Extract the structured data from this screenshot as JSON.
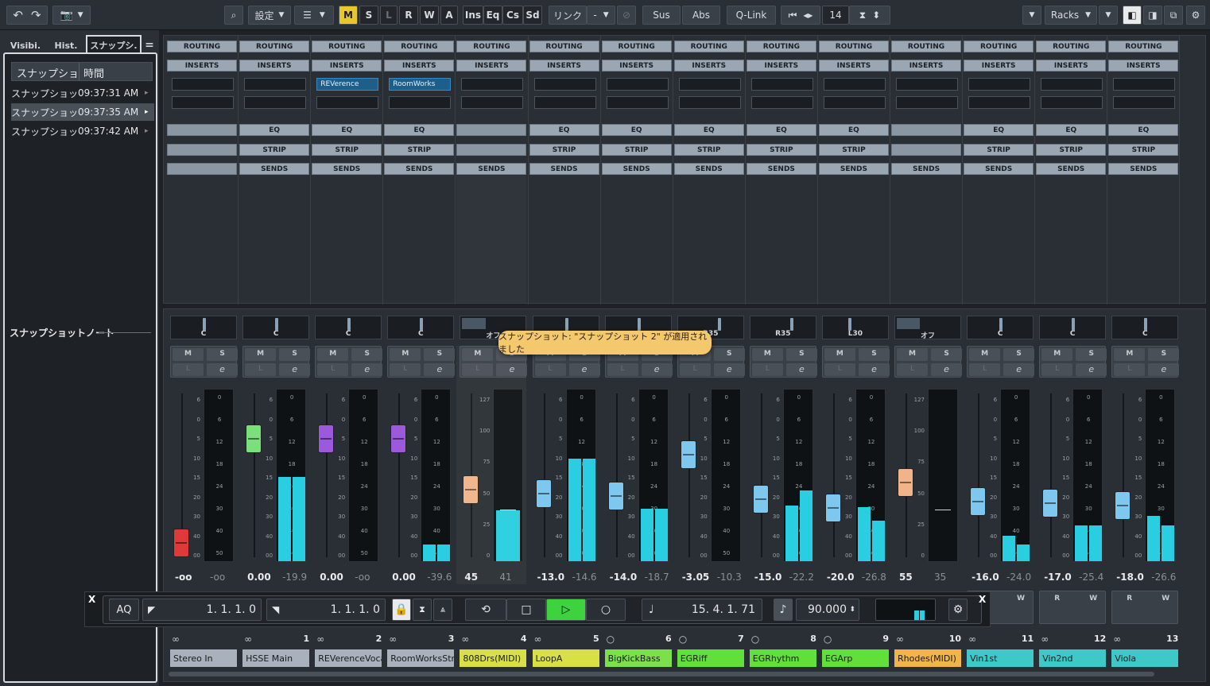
{
  "toolbar": {
    "undo_icon": "undo-icon",
    "redo_icon": "redo-icon",
    "settings_label": "設定",
    "m_label": "M",
    "s_label": "S",
    "l_label": "L",
    "r_label": "R",
    "w_label": "W",
    "a_label": "A",
    "ins_label": "Ins",
    "eq_label": "Eq",
    "cs_label": "Cs",
    "sd_label": "Sd",
    "link_label": "リンク",
    "link_value": "-",
    "sus_label": "Sus",
    "abs_label": "Abs",
    "qlink_label": "Q-Link",
    "channel_count": "14",
    "racks_label": "Racks"
  },
  "left_panel": {
    "tabs": [
      "Visibi.",
      "Hist.",
      "スナップシ."
    ],
    "menu_icon": "=",
    "columns": [
      "スナップショット",
      "時間"
    ],
    "snapshots": [
      {
        "name": "スナップショット",
        "time": "09:37:31 AM"
      },
      {
        "name": "スナップショット",
        "time": "09:37:35 AM"
      },
      {
        "name": "スナップショット",
        "time": "09:37:42 AM"
      }
    ],
    "notes_label": "スナップショットノート"
  },
  "rack": {
    "routing": "ROUTING",
    "inserts": "INSERTS",
    "eq": "EQ",
    "strip": "STRIP",
    "sends": "SENDS",
    "insert_slots": {
      "2": "REVerence",
      "3": "RoomWorks"
    }
  },
  "channels": [
    {
      "num": "",
      "pan": "C",
      "level": "-oo",
      "peak": "-oo",
      "name": "Stereo In",
      "color": "#a9b2bc",
      "cap": "#e0393a",
      "fader": 1.0,
      "meter": [
        0,
        0
      ],
      "fx": false
    },
    {
      "num": "1",
      "pan": "C",
      "level": "0.00",
      "peak": "-19.9",
      "name": "HSSE Main",
      "color": "#a9b2bc",
      "cap": "#7be07b",
      "fader": 0.22,
      "meter": [
        0.5,
        0.5
      ],
      "fx": true
    },
    {
      "num": "2",
      "pan": "C",
      "level": "0.00",
      "peak": "-oo",
      "name": "REVerenceVoca",
      "color": "#a9b2bc",
      "cap": "#9a5adb",
      "fader": 0.22,
      "meter": [
        0,
        0
      ],
      "fx": true
    },
    {
      "num": "3",
      "pan": "C",
      "level": "0.00",
      "peak": "-39.6",
      "name": "RoomWorksStri",
      "color": "#a9b2bc",
      "cap": "#9a5adb",
      "fader": 0.22,
      "meter": [
        0.1,
        0.1
      ],
      "fx": true
    },
    {
      "num": "4",
      "pan": "オフ",
      "level": "45",
      "peak": "41",
      "name": "808Drs(MIDI)",
      "color": "#d8e046",
      "cap": "#f0b488",
      "fader": 0.6,
      "meter": [
        0.3,
        0.3
      ],
      "fx": false,
      "midi": true
    },
    {
      "num": "5",
      "pan": "C",
      "level": "-13.0",
      "peak": "-14.6",
      "name": "LoopA",
      "color": "#d8e046",
      "cap": "#7ec8f0",
      "fader": 0.63,
      "meter": [
        0.61,
        0.61
      ],
      "fx": true
    },
    {
      "num": "6",
      "pan": "C",
      "level": "-14.0",
      "peak": "-18.7",
      "name": "BigKickBass",
      "color": "#7ce04a",
      "cap": "#7ec8f0",
      "fader": 0.65,
      "meter": [
        0.31,
        0.31
      ],
      "fx": true
    },
    {
      "num": "7",
      "pan": "R35",
      "level": "-3.05",
      "peak": "-10.3",
      "name": "EGRiff",
      "color": "#62e03a",
      "cap": "#7ec8f0",
      "fader": 0.34,
      "meter": [
        0,
        0
      ],
      "fx": true
    },
    {
      "num": "8",
      "pan": "R35",
      "level": "-15.0",
      "peak": "-22.2",
      "name": "EGRhythm",
      "color": "#62e03a",
      "cap": "#7ec8f0",
      "fader": 0.67,
      "meter": [
        0.33,
        0.42
      ],
      "fx": true
    },
    {
      "num": "9",
      "pan": "L30",
      "level": "-20.0",
      "peak": "-26.8",
      "name": "EGArp",
      "color": "#62e03a",
      "cap": "#7ec8f0",
      "fader": 0.74,
      "meter": [
        0.32,
        0.24
      ],
      "fx": true
    },
    {
      "num": "10",
      "pan": "オフ",
      "level": "55",
      "peak": "35",
      "name": "Rhodes(MIDI)",
      "color": "#f0b448",
      "cap": "#f0b488",
      "fader": 0.55,
      "meter": [
        0,
        0
      ],
      "fx": false,
      "midi": true
    },
    {
      "num": "11",
      "pan": "C",
      "level": "-16.0",
      "peak": "-24.0",
      "name": "Vin1st",
      "color": "#3ec8c8",
      "cap": "#7ec8f0",
      "fader": 0.69,
      "meter": [
        0.15,
        0.1
      ],
      "fx": true
    },
    {
      "num": "12",
      "pan": "C",
      "level": "-17.0",
      "peak": "-25.4",
      "name": "Vin2nd",
      "color": "#3ec8c8",
      "cap": "#7ec8f0",
      "fader": 0.7,
      "meter": [
        0.21,
        0.21
      ],
      "fx": true
    },
    {
      "num": "13",
      "pan": "C",
      "level": "-18.0",
      "peak": "-26.6",
      "name": "Viola",
      "color": "#3ec8c8",
      "cap": "#7ec8f0",
      "fader": 0.72,
      "meter": [
        0.27,
        0.21
      ],
      "fx": true
    }
  ],
  "scale_db": [
    "6",
    "0",
    "5",
    "10",
    "15",
    "20",
    "30",
    "40",
    "00"
  ],
  "scale_meter": [
    "0",
    "6",
    "12",
    "18",
    "24",
    "30",
    "40",
    "50"
  ],
  "scale_midi": [
    "127",
    "100",
    "75",
    "50",
    "25",
    "0"
  ],
  "tooltip": "スナップショット: \"スナップショット 2\" が適用されました",
  "transport": {
    "close": "X",
    "aq_label": "AQ",
    "left_locator": "1.  1.  1.    0",
    "right_locator": "1.  1.  1.    0",
    "position": "15.  4.  1.  71",
    "tempo": "90.000"
  },
  "mix_labels": {
    "m": "M",
    "s": "S",
    "r": "R",
    "w": "W",
    "l": "L",
    "e": "e"
  }
}
